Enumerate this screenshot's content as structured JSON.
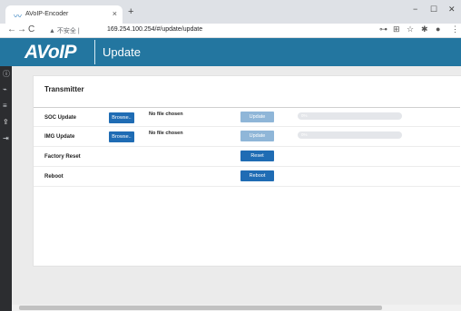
{
  "browser": {
    "tab_title": "AVoIP-Encoder",
    "tab_close": "×",
    "new_tab": "+",
    "minimize": "−",
    "maximize": "☐",
    "close": "✕",
    "back": "←",
    "forward": "→",
    "reload": "C",
    "insecure_label": "▲ 不安全 |",
    "url": "169.254.100.254/#/update/update",
    "toolbar_icons": [
      "key-icon",
      "translate-icon",
      "star-icon",
      "extensions-icon",
      "profile-icon",
      "menu-icon"
    ]
  },
  "header": {
    "logo": "AVoIP",
    "title": "Update"
  },
  "sidebar": {
    "icons": [
      "info-icon",
      "network-icon",
      "settings-icon",
      "update-icon",
      "logout-icon"
    ]
  },
  "card": {
    "title": "Transmitter",
    "rows": [
      {
        "label": "SOC Update",
        "browse": "Browse..",
        "file": "No file chosen",
        "button": "Update",
        "progress": "0%"
      },
      {
        "label": "IMG Update",
        "browse": "Browse..",
        "file": "No file chosen",
        "button": "Update",
        "progress": "0%"
      },
      {
        "label": "Factory Reset",
        "button": "Reset"
      },
      {
        "label": "Reboot",
        "button": "Reboot"
      }
    ]
  },
  "colors": {
    "header_bg": "#2376a0",
    "sidebar_bg": "#2c2d30",
    "button_primary": "#1f6cb4",
    "button_disabled": "#8fb6d8"
  }
}
